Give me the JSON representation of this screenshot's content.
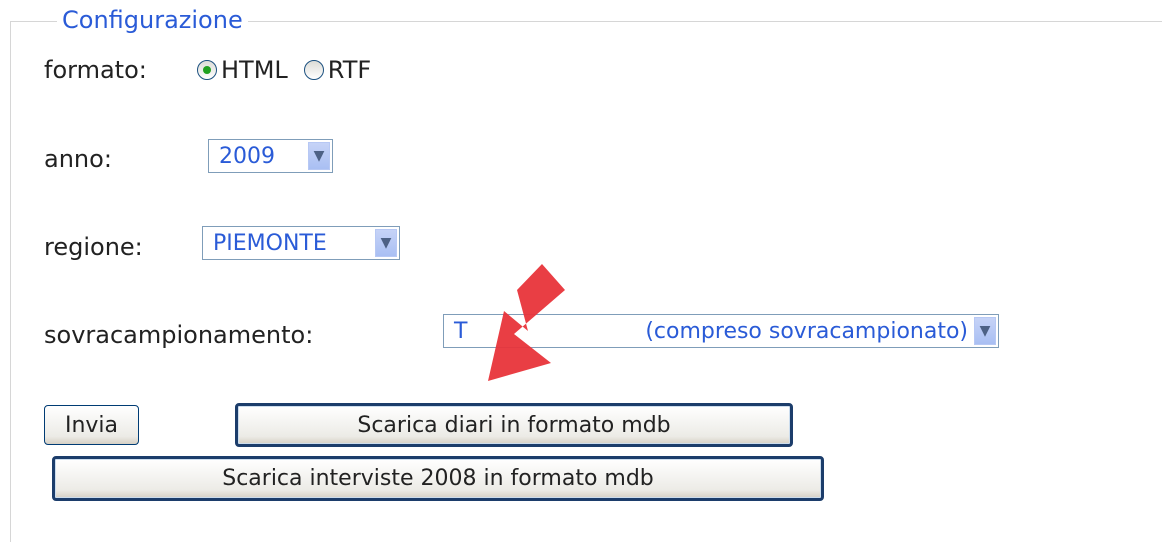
{
  "fieldset": {
    "legend": "Configurazione"
  },
  "formato": {
    "label": "formato:",
    "options": [
      {
        "label": "HTML",
        "checked": true
      },
      {
        "label": "RTF",
        "checked": false
      }
    ]
  },
  "anno": {
    "label": "anno:",
    "value": "2009"
  },
  "regione": {
    "label": "regione:",
    "value": "PIEMONTE"
  },
  "sovracampionamento": {
    "label": "sovracampionamento:",
    "value_visible_start": "T",
    "value_visible_end": "(compreso sovracampionato)"
  },
  "buttons": {
    "invia": "Invia",
    "scarica_diari": "Scarica diari in formato mdb",
    "scarica_interviste": "Scarica interviste 2008 in formato mdb"
  },
  "annotation": {
    "arrow_color": "#e8343a",
    "arrow_icon": "red-arrow-pointer-icon"
  }
}
